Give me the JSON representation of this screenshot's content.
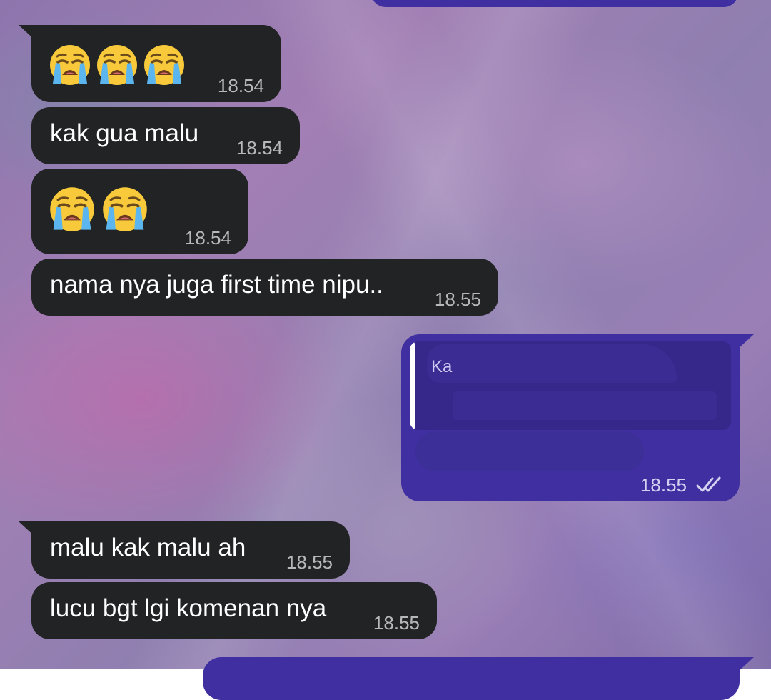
{
  "chat": {
    "messages": [
      {
        "id": "m1",
        "direction": "incoming",
        "type": "emoji",
        "emoji": [
          "loudly-crying-face",
          "loudly-crying-face",
          "loudly-crying-face"
        ],
        "time": "18.54"
      },
      {
        "id": "m2",
        "direction": "incoming",
        "type": "text",
        "text": "kak gua malu",
        "time": "18.54"
      },
      {
        "id": "m3",
        "direction": "incoming",
        "type": "emoji",
        "emoji": [
          "loudly-crying-face",
          "loudly-crying-face"
        ],
        "time": "18.54"
      },
      {
        "id": "m4",
        "direction": "incoming",
        "type": "text",
        "text": "nama nya juga first time nipu..",
        "time": "18.55"
      },
      {
        "id": "m5",
        "direction": "outgoing",
        "type": "reply",
        "reply_author": "Ka",
        "reply_text": "",
        "text": "",
        "time": "18.55",
        "status": "read",
        "status_icon": "double-check-icon",
        "redacted": true
      },
      {
        "id": "m6",
        "direction": "incoming",
        "type": "text",
        "text": "malu kak malu ah",
        "time": "18.55"
      },
      {
        "id": "m7",
        "direction": "incoming",
        "type": "text",
        "text": "lucu bgt lgi komenan nya",
        "time": "18.55"
      }
    ]
  },
  "colors": {
    "incoming_bubble": "#222324",
    "outgoing_bubble": "#3f2fa0",
    "reply_quote": "#35288a",
    "timestamp_incoming": "#b8b8bc",
    "timestamp_outgoing": "#d5d0f0"
  }
}
